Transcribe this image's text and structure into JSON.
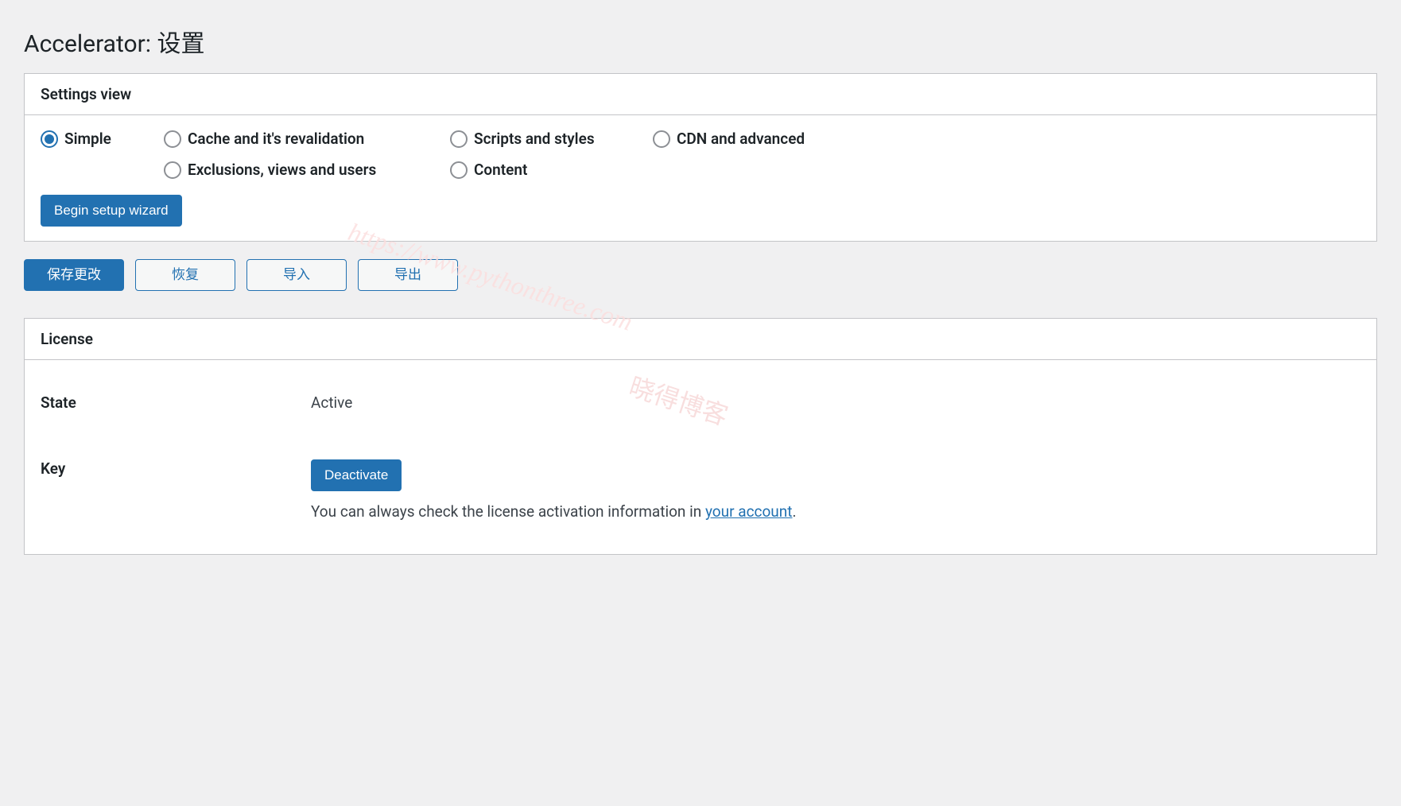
{
  "page_title": "Accelerator: 设置",
  "settings_view": {
    "panel_title": "Settings view",
    "options": {
      "simple": "Simple",
      "cache_reval": "Cache and it's revalidation",
      "scripts_styles": "Scripts and styles",
      "cdn_advanced": "CDN and advanced",
      "exclusions": "Exclusions, views and users",
      "content": "Content"
    },
    "setup_wizard_label": "Begin setup wizard"
  },
  "actions": {
    "save": "保存更改",
    "restore": "恢复",
    "import": "导入",
    "export": "导出"
  },
  "license": {
    "panel_title": "License",
    "state_label": "State",
    "state_value": "Active",
    "key_label": "Key",
    "deactivate_label": "Deactivate",
    "desc_prefix": "You can always check the license activation information in ",
    "desc_link": "your account",
    "desc_suffix": "."
  },
  "watermark": {
    "url": "https://www.pythonthree.com",
    "name": "晓得博客"
  }
}
